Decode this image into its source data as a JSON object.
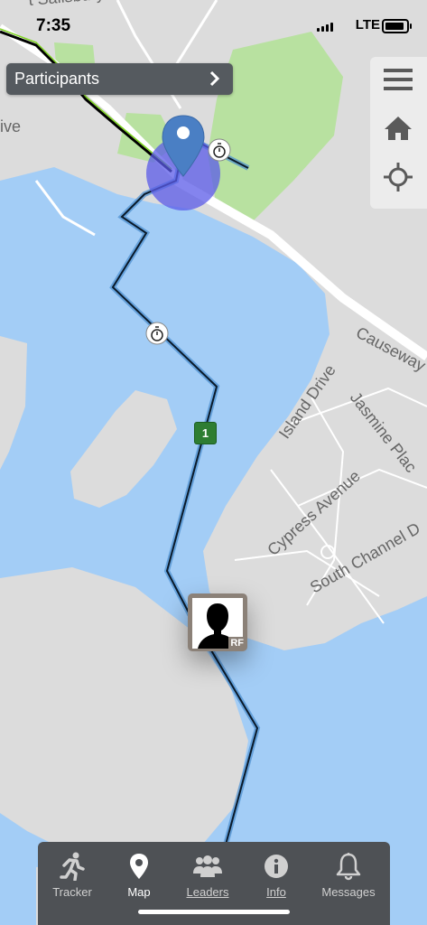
{
  "status_bar": {
    "time": "7:35",
    "network": "LTE",
    "battery_level": 0.9
  },
  "participants_button": {
    "label": "Participants"
  },
  "map": {
    "street_labels": {
      "causeway": "Causeway",
      "island_drive": "Island Drive",
      "jasmine": "Jasmine Plac",
      "cypress": "Cypress Avenue",
      "south_channel": "South Channel D",
      "salisbury": "t Salisbury St",
      "drive_partial": "ive"
    },
    "split_marker_label": "1",
    "participant_initials": "RF"
  },
  "tabs": [
    {
      "label": "Tracker",
      "icon": "runner-icon",
      "active": false
    },
    {
      "label": "Map",
      "icon": "map-pin-icon",
      "active": true
    },
    {
      "label": "Leaders",
      "icon": "group-icon",
      "active": false
    },
    {
      "label": "Info",
      "icon": "info-icon",
      "active": false
    },
    {
      "label": "Messages",
      "icon": "bell-icon",
      "active": false
    }
  ],
  "colors": {
    "water": "#a3cdf6",
    "land": "#dcdcdc",
    "park": "#b8e1a0",
    "route": "#0a1a2a",
    "route_glow": "#4a8fd0",
    "location_circle": "#5b5be8",
    "tab_bar": "#4e5155"
  }
}
